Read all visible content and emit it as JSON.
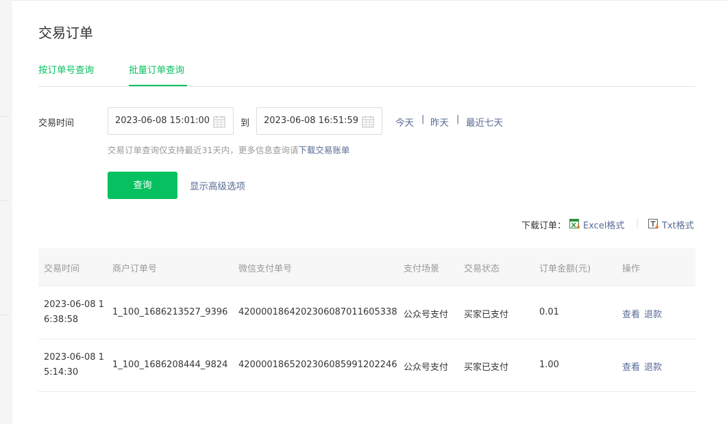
{
  "page": {
    "title": "交易订单"
  },
  "tabs": [
    {
      "label": "按订单号查询",
      "active": false
    },
    {
      "label": "批量订单查询",
      "active": true
    }
  ],
  "filter": {
    "time_label": "交易时间",
    "start": "2023-06-08 15:01:00",
    "to_label": "到",
    "end": "2023-06-08 16:51:59",
    "quick": [
      "今天",
      "昨天",
      "最近七天"
    ],
    "separator": "|",
    "hint_text": "交易订单查询仅支持最近31天内，更多信息查询请",
    "hint_link": "下载交易账单"
  },
  "actions": {
    "query": "查询",
    "advanced": "显示高级选项"
  },
  "download": {
    "label": "下载订单：",
    "excel": "Excel格式",
    "sep": "|",
    "txt": "Txt格式"
  },
  "table": {
    "headers": [
      "交易时间",
      "商户订单号",
      "微信支付单号",
      "支付场景",
      "交易状态",
      "订单金额(元)",
      "操作"
    ],
    "rows": [
      {
        "time": "2023-06-08 16:38:58",
        "merchant_no": "1_100_1686213527_9396",
        "wx_no": "4200001864202306087011605338",
        "scene": "公众号支付",
        "status": "买家已支付",
        "amount": "0.01",
        "view": "查看",
        "refund": "退款"
      },
      {
        "time": "2023-06-08 15:14:30",
        "merchant_no": "1_100_1686208444_9824",
        "wx_no": "4200001865202306085991202246",
        "scene": "公众号支付",
        "status": "买家已支付",
        "amount": "1.00",
        "view": "查看",
        "refund": "退款"
      }
    ]
  },
  "colors": {
    "accent": "#07c160",
    "link": "#576b95",
    "muted": "#999999"
  },
  "icons": [
    "calendar-icon",
    "excel-file-icon",
    "txt-file-icon"
  ]
}
